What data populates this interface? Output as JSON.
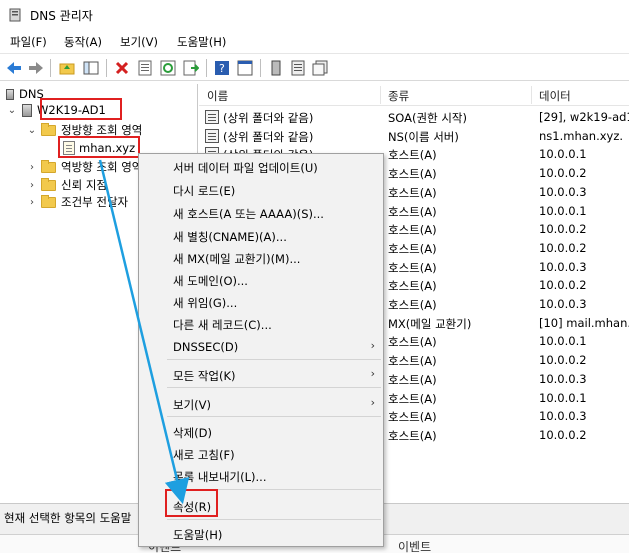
{
  "window": {
    "title": "DNS 관리자"
  },
  "menu": [
    "파일(F)",
    "동작(A)",
    "보기(V)",
    "도움말(H)"
  ],
  "tree": {
    "root": "DNS",
    "server": "W2K19-AD1",
    "forward_zones": "정방향 조회 영역",
    "zone": "mhan.xyz",
    "reverse_zones": "역방향 조회 영역",
    "trust_points": "신뢰 지점",
    "conditional_forwarders": "조건부 전달자"
  },
  "list": {
    "columns": [
      "이름",
      "종류",
      "데이터"
    ],
    "rows": [
      {
        "name": "(상위 폴더와 같음)",
        "type": "SOA(권한 시작)",
        "data": "[29], w2k19-ad1"
      },
      {
        "name": "(상위 폴더와 같음)",
        "type": "NS(이름 서버)",
        "data": "ns1.mhan.xyz."
      },
      {
        "name": "(상위 폴더와 같음)",
        "type": "호스트(A)",
        "data": "10.0.0.1"
      },
      {
        "name": "",
        "type": "호스트(A)",
        "data": "10.0.0.2"
      },
      {
        "name": "",
        "type": "호스트(A)",
        "data": "10.0.0.3"
      },
      {
        "name": "",
        "type": "호스트(A)",
        "data": "10.0.0.1"
      },
      {
        "name": "",
        "type": "호스트(A)",
        "data": "10.0.0.2"
      },
      {
        "name": "",
        "type": "호스트(A)",
        "data": "10.0.0.2"
      },
      {
        "name": "",
        "type": "호스트(A)",
        "data": "10.0.0.3"
      },
      {
        "name": "",
        "type": "호스트(A)",
        "data": "10.0.0.2"
      },
      {
        "name": "",
        "type": "호스트(A)",
        "data": "10.0.0.3"
      },
      {
        "name": "",
        "type": "MX(메일 교환기)",
        "data": "[10]  mail.mhan."
      },
      {
        "name": "",
        "type": "호스트(A)",
        "data": "10.0.0.1"
      },
      {
        "name": "",
        "type": "호스트(A)",
        "data": "10.0.0.2"
      },
      {
        "name": "",
        "type": "호스트(A)",
        "data": "10.0.0.3"
      },
      {
        "name": "",
        "type": "호스트(A)",
        "data": "10.0.0.1"
      },
      {
        "name": "",
        "type": "호스트(A)",
        "data": "10.0.0.3"
      },
      {
        "name": "",
        "type": "호스트(A)",
        "data": "10.0.0.2"
      }
    ]
  },
  "context_menu": {
    "items": [
      "서버 데이터 파일 업데이트(U)",
      "다시 로드(E)",
      "새 호스트(A 또는 AAAA)(S)...",
      "새 별칭(CNAME)(A)...",
      "새 MX(메일 교환기)(M)...",
      "새 도메인(O)...",
      "새 위임(G)...",
      "다른 새 레코드(C)...",
      "DNSSEC(D)",
      "모든 작업(K)",
      "보기(V)",
      "삭제(D)",
      "새로 고침(F)",
      "목록 내보내기(L)...",
      "속성(R)",
      "도움말(H)"
    ]
  },
  "status": {
    "text": "현재 선택한 항목의 도움말",
    "event_left": "이벤트",
    "event_right": "이벤트"
  },
  "colors": {
    "highlight": "#e02020",
    "arrow": "#1e9fe0"
  }
}
